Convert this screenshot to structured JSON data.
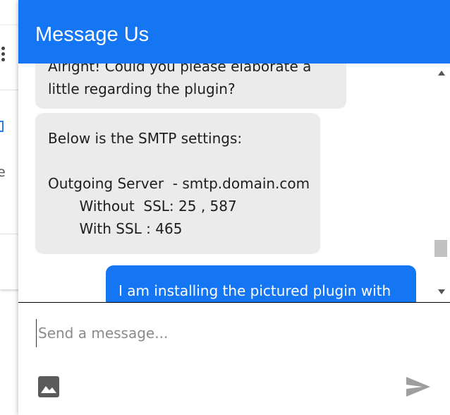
{
  "header": {
    "title": "Message Us",
    "color": "#1476f2"
  },
  "messages": [
    {
      "sender": "agent",
      "text": "Alright! Could you please elaborate a\nlittle regarding the plugin?"
    },
    {
      "sender": "agent",
      "text": "Below is the SMTP settings:\n\nOutgoing Server  - smtp.domain.com\n       Without  SSL: 25 , 587\n       With SSL : 465"
    },
    {
      "sender": "user",
      "text": "I am installing the pictured plugin with"
    }
  ],
  "composer": {
    "placeholder": "Send a message...",
    "value": ""
  },
  "icons": {
    "attach": "image-icon",
    "send": "send-icon"
  },
  "colors": {
    "agent_bubble": "#ebebeb",
    "user_bubble": "#1476f2"
  }
}
